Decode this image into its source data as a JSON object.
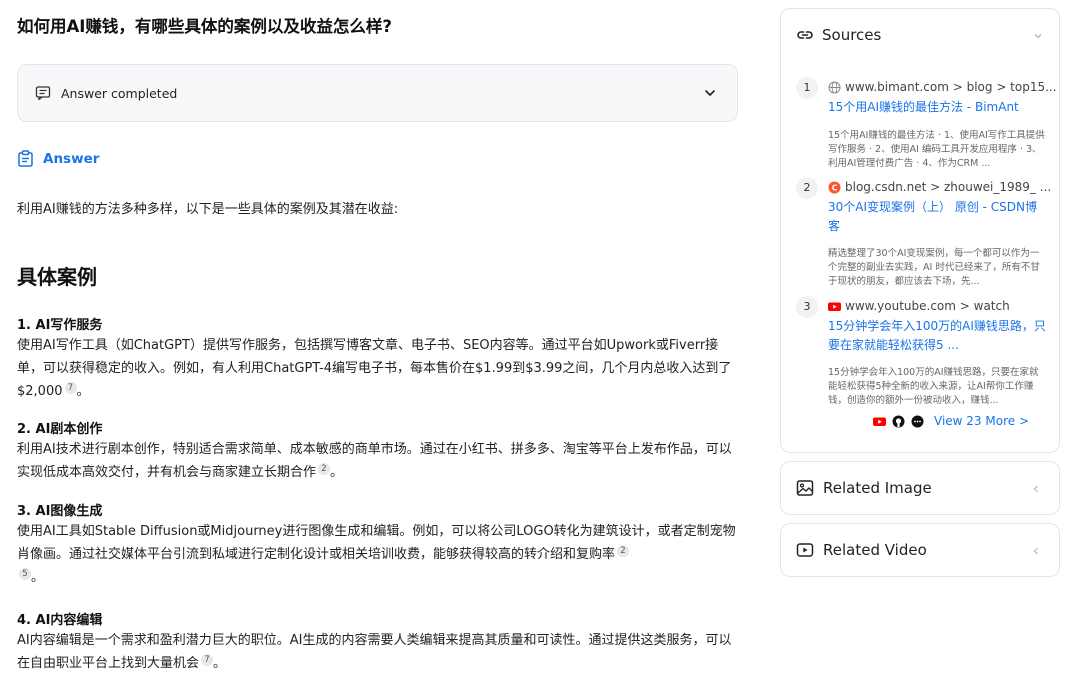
{
  "question": "如何用AI赚钱，有哪些具体的案例以及收益怎么样?",
  "status": {
    "text": "Answer completed"
  },
  "answer": {
    "label": "Answer",
    "intro": "利用AI赚钱的方法多种多样，以下是一些具体的案例及其潜在收益:",
    "section_title": "具体案例",
    "items": [
      {
        "title": "1. AI写作服务",
        "body": "使用AI写作工具（如ChatGPT）提供写作服务，包括撰写博客文章、电子书、SEO内容等。通过平台如Upwork或Fiverr接单，可以获得稳定的收入。例如，有人利用ChatGPT-4编写电子书，每本售价在$1.99到$3.99之间，几个月内总收入达到了$2,000",
        "cites": [
          "7"
        ]
      },
      {
        "title": "2. AI剧本创作",
        "body": "利用AI技术进行剧本创作，特别适合需求简单、成本敏感的商单市场。通过在小红书、拼多多、淘宝等平台上发布作品，可以实现低成本高效交付，并有机会与商家建立长期合作",
        "cites": [
          "2"
        ]
      },
      {
        "title": "3. AI图像生成",
        "body": "使用AI工具如Stable Diffusion或Midjourney进行图像生成和编辑。例如，可以将公司LOGO转化为建筑设计，或者定制宠物肖像画。通过社交媒体平台引流到私域进行定制化设计或相关培训收费，能够获得较高的转介绍和复购率",
        "cites": [
          "2",
          "5"
        ],
        "tail": "。"
      },
      {
        "title": "4. AI内容编辑",
        "body": "AI内容编辑是一个需求和盈利潜力巨大的职位。AI生成的内容需要人类编辑来提高其质量和可读性。通过提供这类服务，可以在自由职业平台上找到大量机会",
        "cites": [
          "7"
        ]
      }
    ]
  },
  "sources": {
    "title": "Sources",
    "items": [
      {
        "num": "1",
        "domain": "www.bimant.com > blog > top15...",
        "title": "15个用AI赚钱的最佳方法 - BimAnt",
        "snippet": "15个用AI赚钱的最佳方法 · 1、使用AI写作工具提供写作服务 · 2、使用AI 编码工具开发应用程序 · 3、利用AI管理付费广告 · 4、作为CRM ..."
      },
      {
        "num": "2",
        "domain": "blog.csdn.net > zhouwei_1989_ ...",
        "title": "30个AI变现案例（上） 原创 - CSDN博客",
        "snippet": "精选整理了30个AI变现案例，每一个都可以作为一个完整的副业去实践，AI 时代已经来了，所有不甘于现状的朋友，都应该去下场，先..."
      },
      {
        "num": "3",
        "domain": "www.youtube.com > watch",
        "title": "15分钟学会年入100万的AI赚钱思路，只要在家就能轻松获得5 ...",
        "snippet": "15分钟学会年入100万的AI赚钱思路，只要在家就能轻松获得5种全新的收入来源，让AI帮你工作赚钱，创造你的额外一份被动收入，赚钱..."
      }
    ],
    "more_label": "View 23 More >"
  },
  "panels": {
    "related_image": "Related Image",
    "related_video": "Related Video"
  },
  "colors": {
    "accent": "#1a73e8",
    "youtube": "#ff0000",
    "csdn": "#fc5531"
  }
}
